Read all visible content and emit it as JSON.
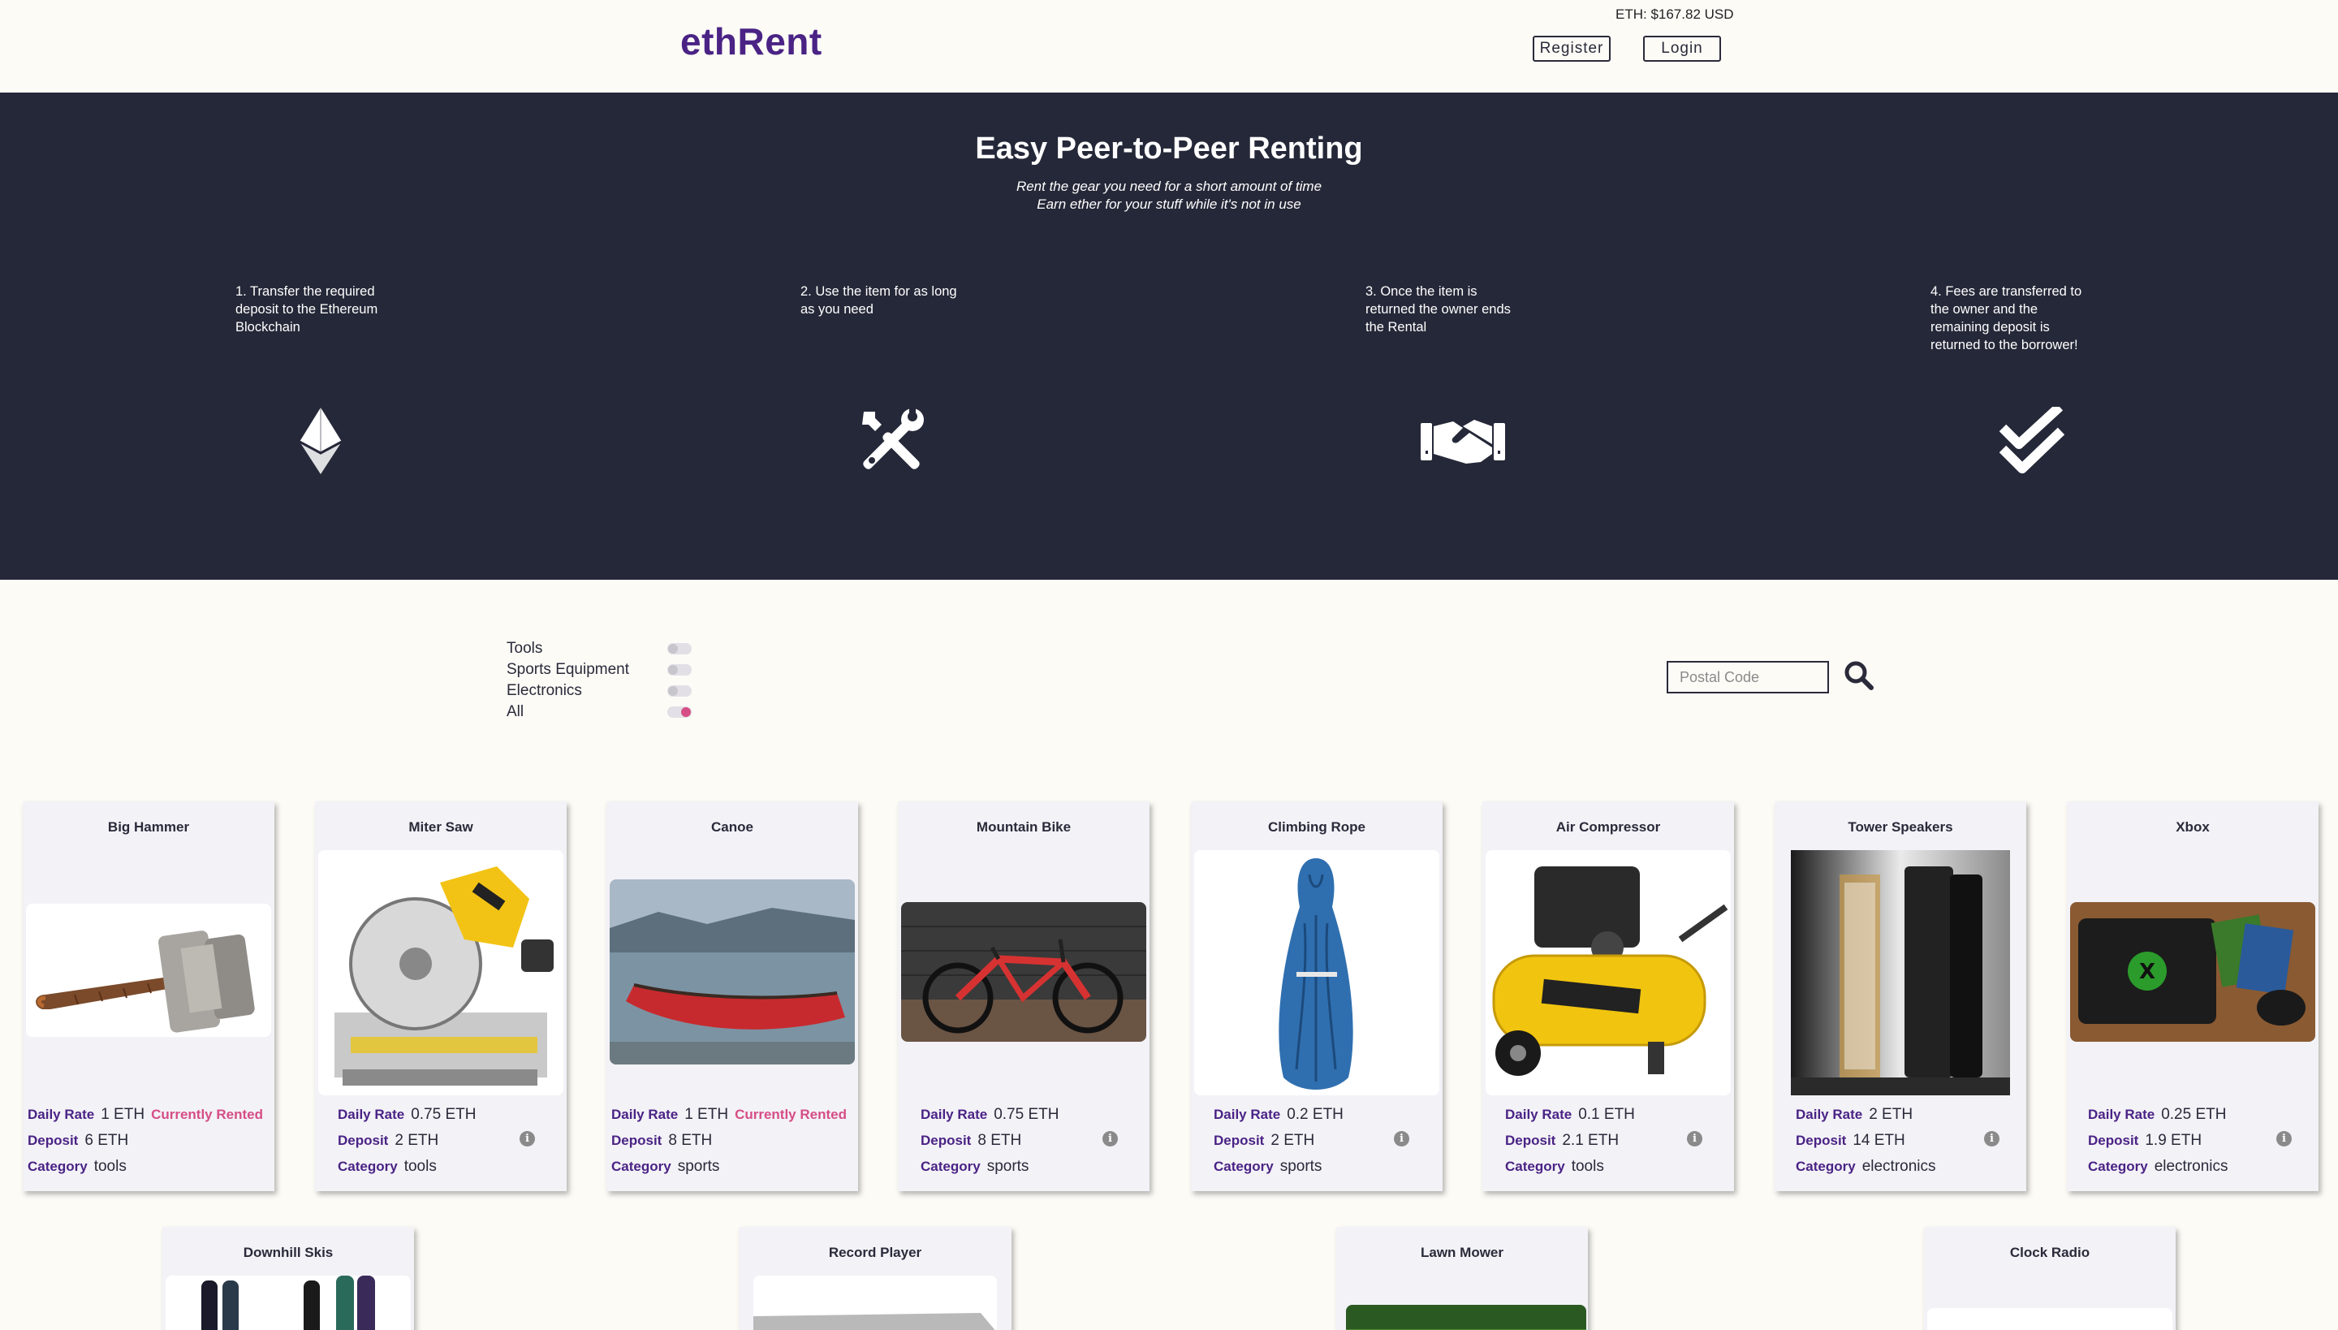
{
  "header": {
    "logo": "ethRent",
    "eth_price": "ETH: $167.82 USD",
    "register_label": "Register",
    "login_label": "Login"
  },
  "hero": {
    "title": "Easy Peer-to-Peer Renting",
    "subtitle_1": "Rent the gear you need for a short amount of time",
    "subtitle_2": "Earn ether for your stuff while it's not in use",
    "steps": [
      {
        "text": "1. Transfer the required deposit to the Ethereum Blockchain",
        "icon": "ethereum-icon"
      },
      {
        "text": "2. Use the item for as long as you need",
        "icon": "tools-icon"
      },
      {
        "text": "3. Once the item is returned the owner ends the Rental",
        "icon": "handshake-icon"
      },
      {
        "text": "4. Fees are transferred to the owner and the remaining deposit is returned to the borrower!",
        "icon": "double-check-icon"
      }
    ]
  },
  "filters": [
    {
      "label": "Tools",
      "on": false
    },
    {
      "label": "Sports Equipment",
      "on": false
    },
    {
      "label": "Electronics",
      "on": false
    },
    {
      "label": "All",
      "on": true
    }
  ],
  "search": {
    "placeholder": "Postal Code",
    "icon": "search-icon"
  },
  "labels": {
    "daily_rate": "Daily Rate",
    "deposit": "Deposit",
    "category": "Category",
    "rented": "Currently Rented",
    "info_icon": "i"
  },
  "items": [
    {
      "name": "Big Hammer",
      "rate": "1 ETH",
      "deposit": "6 ETH",
      "category": "tools",
      "rented": true
    },
    {
      "name": "Miter Saw",
      "rate": "0.75 ETH",
      "deposit": "2 ETH",
      "category": "tools",
      "rented": false
    },
    {
      "name": "Canoe",
      "rate": "1 ETH",
      "deposit": "8 ETH",
      "category": "sports",
      "rented": true
    },
    {
      "name": "Mountain Bike",
      "rate": "0.75 ETH",
      "deposit": "8 ETH",
      "category": "sports",
      "rented": false
    },
    {
      "name": "Climbing Rope",
      "rate": "0.2 ETH",
      "deposit": "2 ETH",
      "category": "sports",
      "rented": false
    },
    {
      "name": "Air Compressor",
      "rate": "0.1 ETH",
      "deposit": "2.1 ETH",
      "category": "tools",
      "rented": false
    },
    {
      "name": "Tower Speakers",
      "rate": "2 ETH",
      "deposit": "14 ETH",
      "category": "electronics",
      "rented": false
    },
    {
      "name": "Xbox",
      "rate": "0.25 ETH",
      "deposit": "1.9 ETH",
      "category": "electronics",
      "rented": false
    }
  ],
  "items_row2": [
    "Downhill Skis",
    "Record Player",
    "Lawn Mower",
    "Clock Radio"
  ],
  "colors": {
    "brand": "#4a2385",
    "accent": "#d64d86",
    "hero_bg": "#252838",
    "page_bg": "#fcfbf6"
  }
}
